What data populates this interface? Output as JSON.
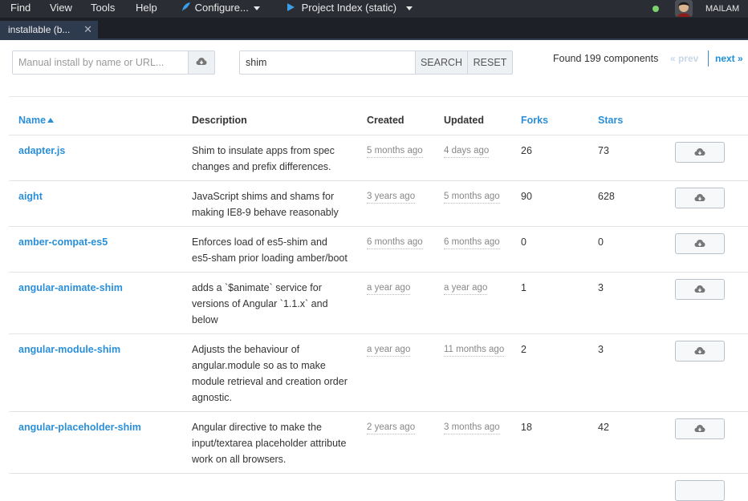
{
  "menu": {
    "find": "Find",
    "view": "View",
    "tools": "Tools",
    "help": "Help",
    "configure": "Configure...",
    "project": "Project Index (static)",
    "user": "MAILAM"
  },
  "tab": {
    "label": "installable (b..."
  },
  "install": {
    "placeholder": "Manual install by name or URL..."
  },
  "search": {
    "value": "shim",
    "search_label": "SEARCH",
    "reset_label": "RESET"
  },
  "results": {
    "found": "Found 199 components",
    "prev": "« prev",
    "next": "next »"
  },
  "columns": {
    "name": "Name",
    "description": "Description",
    "created": "Created",
    "updated": "Updated",
    "forks": "Forks",
    "stars": "Stars"
  },
  "rows": [
    {
      "name": "adapter.js",
      "desc": [
        "Shim to insulate apps from spec",
        "changes and prefix differences."
      ],
      "created": "5 months ago",
      "updated": "4 days ago",
      "forks": "26",
      "stars": "73"
    },
    {
      "name": "aight",
      "desc": [
        "JavaScript shims and shams for",
        "making IE8-9 behave reasonably"
      ],
      "created": "3 years ago",
      "updated": "5 months ago",
      "forks": "90",
      "stars": "628"
    },
    {
      "name": "amber-compat-es5",
      "desc": [
        "Enforces load of es5-shim and",
        "es5-sham prior loading amber/boot"
      ],
      "created": "6 months ago",
      "updated": "6 months ago",
      "forks": "0",
      "stars": "0"
    },
    {
      "name": "angular-animate-shim",
      "desc": [
        "adds a `$animate` service for",
        "versions of Angular `1.1.x` and",
        "below"
      ],
      "created": "a year ago",
      "updated": "a year ago",
      "forks": "1",
      "stars": "3"
    },
    {
      "name": "angular-module-shim",
      "desc": [
        "Adjusts the behaviour of",
        "angular.module so as to make",
        "module retrieval and creation order",
        "agnostic."
      ],
      "created": "a year ago",
      "updated": "11 months ago",
      "forks": "2",
      "stars": "3"
    },
    {
      "name": "angular-placeholder-shim",
      "desc": [
        "Angular directive to make the",
        "input/textarea placeholder attribute",
        "work on all browsers."
      ],
      "created": "2 years ago",
      "updated": "3 months ago",
      "forks": "18",
      "stars": "42"
    }
  ],
  "icons": {
    "install": "cloud-download-icon",
    "configure": "feather-icon",
    "project": "play-icon",
    "status": "green-dot",
    "avatar": "avatar"
  },
  "colors": {
    "link": "#2a8fd8",
    "menubar": "#2b2d34",
    "tab": "#2e3a4d"
  }
}
